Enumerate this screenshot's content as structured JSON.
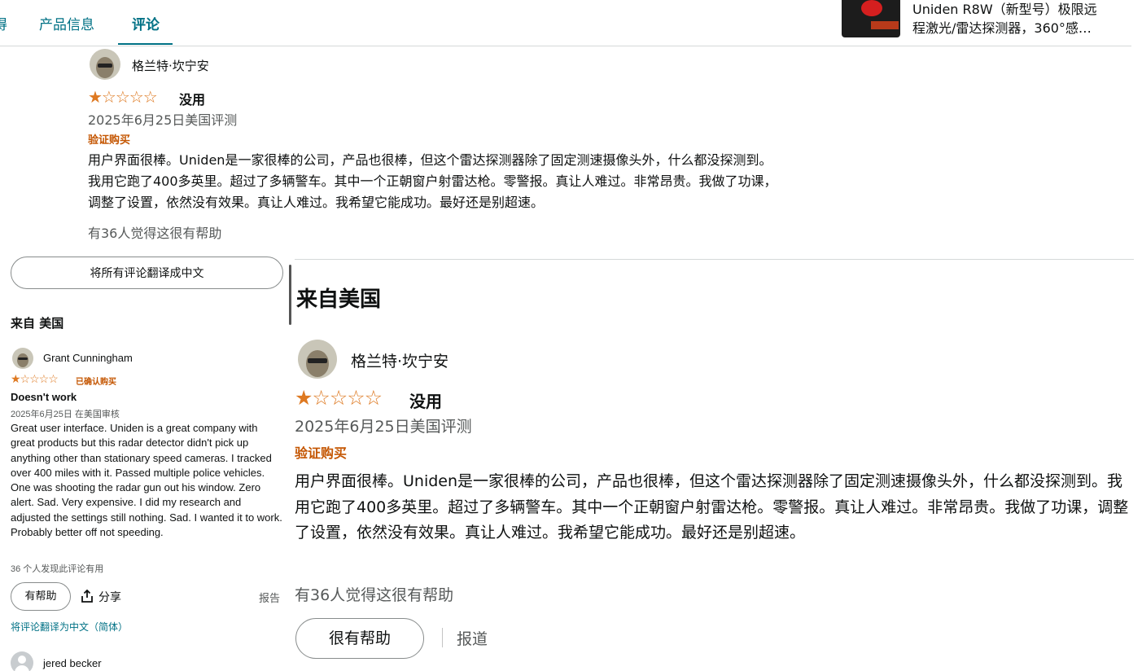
{
  "nav": {
    "tab_cut": "得",
    "tab_product_info": "产品信息",
    "tab_reviews": "评论"
  },
  "product": {
    "title_line1": "Uniden R8W（新型号）极限远",
    "title_line2": "程激光/雷达探测器，360°感…"
  },
  "top_review": {
    "reviewer": "格兰特·坎宁安",
    "stars": "★☆☆☆☆",
    "headline": "没用",
    "date": "2025年6月25日美国评测",
    "verified": "验证购买",
    "body": "用户界面很棒。Uniden是一家很棒的公司，产品也很棒，但这个雷达探测器除了固定测速摄像头外，什么都没探测到。我用它跑了400多英里。超过了多辆警车。其中一个正朝窗户射雷达枪。零警报。真让人难过。非常昂贵。我做了功课，调整了设置，依然没有效果。真让人难过。我希望它能成功。最好还是别超速。",
    "helpful": "有36人觉得这很有帮助"
  },
  "left_column": {
    "translate_all": "将所有评论翻译成中文",
    "section_title": "来自 美国",
    "review": {
      "reviewer": "Grant Cunningham",
      "stars": "★☆☆☆☆",
      "verified": "已确认购买",
      "headline": "Doesn't work",
      "date": "2025年6月25日 在美国审核",
      "body": "Great user interface. Uniden is a great company with great products but this radar detector didn't pick up anything other than stationary speed cameras. I tracked over 400 miles with it. Passed multiple police vehicles. One was shooting the radar gun out his window. Zero alert. Sad. Very expensive. I did my research and adjusted the settings still nothing. Sad. I wanted it to work. Probably better off not speeding.",
      "helpful": "36 个人发现此评论有用"
    },
    "helpful_button": "有帮助",
    "share": "分享",
    "report": "报告",
    "translate_link": "将评论翻译为中文（简体）",
    "next_reviewer": "jered becker"
  },
  "right_panel": {
    "title": "来自美国",
    "reviewer": "格兰特·坎宁安",
    "stars": "★☆☆☆☆",
    "headline": "没用",
    "date": "2025年6月25日美国评测",
    "verified": "验证购买",
    "body": "用户界面很棒。Uniden是一家很棒的公司，产品也很棒，但这个雷达探测器除了固定测速摄像头外，什么都没探测到。我用它跑了400多英里。超过了多辆警车。其中一个正朝窗户射雷达枪。零警报。真让人难过。非常昂贵。我做了功课，调整了设置，依然没有效果。真让人难过。我希望它能成功。最好还是别超速。",
    "helpful": "有36人觉得这很有帮助",
    "helpful_button": "很有帮助",
    "report": "报道"
  },
  "colors": {
    "link": "#007185",
    "star": "#de7921",
    "verified": "#c45500",
    "muted": "#565959"
  }
}
